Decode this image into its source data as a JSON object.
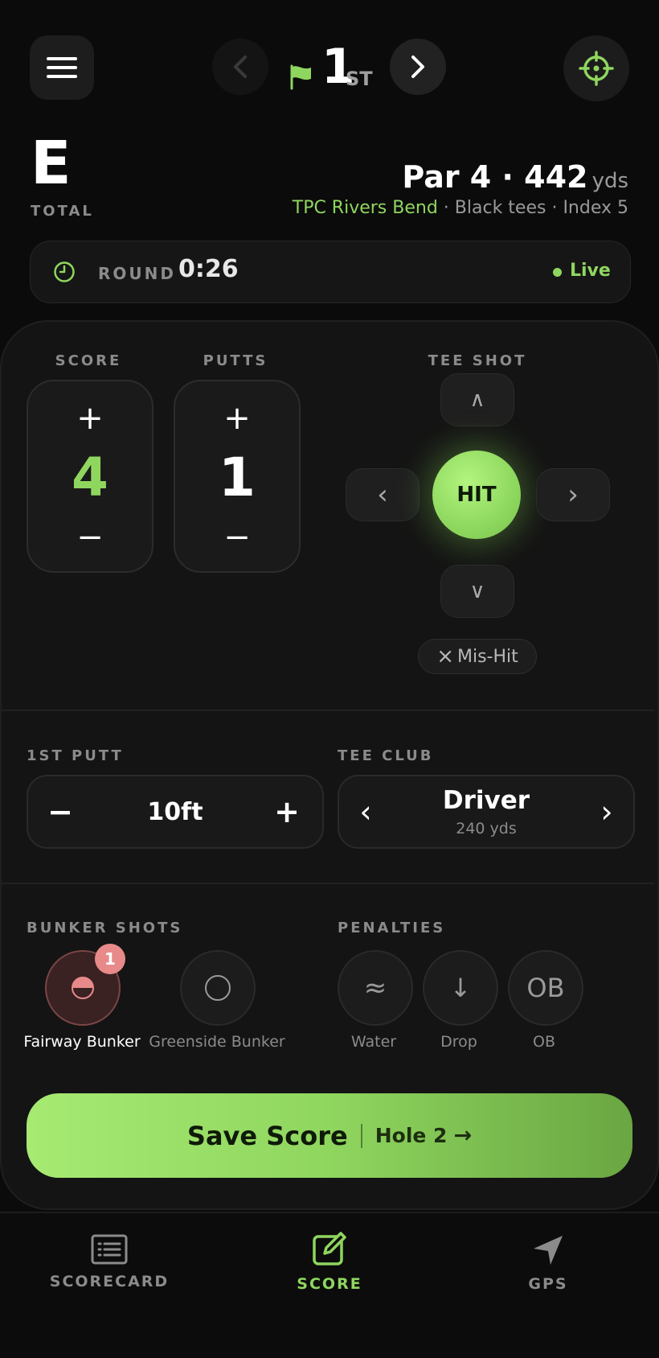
{
  "header": {
    "hole_number": "1",
    "hole_suffix": "ST"
  },
  "summary": {
    "total_value": "E",
    "total_label": "TOTAL",
    "par_line": "Par 4 · 442",
    "yds_unit": "yds",
    "course": "TPC Rivers Bend",
    "course_details": " · Black tees · Index 5"
  },
  "round": {
    "label": "ROUND",
    "time": "0:26",
    "status": "Live"
  },
  "score": {
    "label": "SCORE",
    "value": "4",
    "plus": "+",
    "minus": "−"
  },
  "putts": {
    "label": "PUTTS",
    "value": "1",
    "plus": "+",
    "minus": "−"
  },
  "tee_shot": {
    "label": "TEE SHOT",
    "hit": "HIT",
    "up": "∧",
    "down": "∨",
    "left": "‹",
    "right": "›",
    "mishit": "Mis-Hit",
    "mishit_icon": "×"
  },
  "first_putt": {
    "label": "1ST PUTT",
    "value": "10ft",
    "minus": "−",
    "plus": "+"
  },
  "tee_club": {
    "label": "TEE CLUB",
    "club": "Driver",
    "distance": "240 yds",
    "prev": "‹",
    "next": "›"
  },
  "bunker": {
    "label": "BUNKER SHOTS",
    "items": [
      {
        "label": "Fairway Bunker",
        "badge": "1"
      },
      {
        "label": "Greenside Bunker"
      }
    ]
  },
  "penalties": {
    "label": "PENALTIES",
    "items": [
      {
        "label": "Water",
        "glyph": "≈"
      },
      {
        "label": "Drop",
        "glyph": "↓"
      },
      {
        "label": "OB",
        "glyph": "OB"
      }
    ]
  },
  "save": {
    "label": "Save Score",
    "next": "Hole 2",
    "arrow": "→"
  },
  "nav": {
    "items": [
      {
        "label": "SCORECARD",
        "icon": "scorecard-icon"
      },
      {
        "label": "SCORE",
        "icon": "edit-icon",
        "active": true
      },
      {
        "label": "GPS",
        "icon": "navigation-arrow-icon"
      }
    ]
  },
  "colors": {
    "accent": "#8fd65f",
    "background": "#0b0b0b",
    "card": "#141414",
    "bunker_active": "#e88a8a"
  }
}
